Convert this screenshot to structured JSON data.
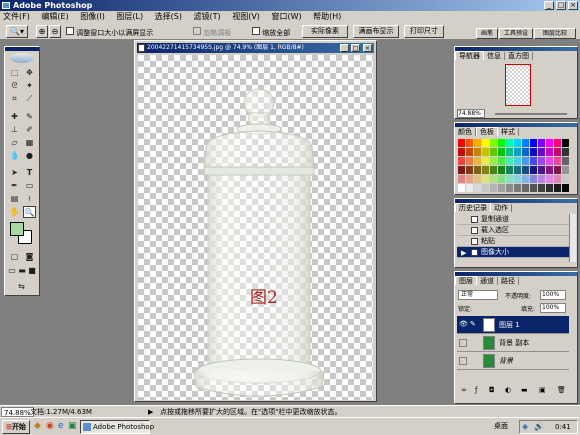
{
  "app": {
    "title": "Adobe Photoshop"
  },
  "menu": [
    "文件(F)",
    "编辑(E)",
    "图像(I)",
    "图层(L)",
    "选择(S)",
    "滤镜(T)",
    "视图(V)",
    "窗口(W)",
    "帮助(H)"
  ],
  "options": {
    "resize_window": "调整窗口大小以满屏显示",
    "ignore_palettes": "忽略调板",
    "zoom_all": "缩放全部",
    "actual_pixels": "实际像素",
    "fit_screen": "满画布显示",
    "print_size": "打印尺寸",
    "right_tabs": [
      "画笔",
      "工具预设",
      "图层比较"
    ]
  },
  "document": {
    "title": "2004227141573495S.jpg @ 74.9% (图层 1, RGB/8#)",
    "label": "图2",
    "label_color": "#b02020"
  },
  "navigator": {
    "tabs": [
      "导航器",
      "信息",
      "直方图"
    ],
    "zoom": "74.88%"
  },
  "color_panel": {
    "tabs": [
      "颜色",
      "色板",
      "样式"
    ]
  },
  "history": {
    "tabs": [
      "历史记录",
      "动作"
    ],
    "items": [
      {
        "label": "复制通道",
        "selected": false
      },
      {
        "label": "载入选区",
        "selected": false
      },
      {
        "label": "粘贴",
        "selected": false
      },
      {
        "label": "图像大小",
        "selected": true
      }
    ]
  },
  "layers": {
    "tabs": [
      "图层",
      "通道",
      "路径"
    ],
    "mode": "正常",
    "opacity_label": "不透明度:",
    "opacity": "100%",
    "lock_label": "锁定:",
    "fill_label": "填充:",
    "fill": "100%",
    "rows": [
      {
        "name": "图层 1",
        "selected": true
      },
      {
        "name": "背景 副本",
        "selected": false
      },
      {
        "name": "背景",
        "selected": false
      }
    ]
  },
  "status": {
    "zoom": "74.88%",
    "doc_size": "文档:1.27M/4.63M",
    "hint": "点按或拖移所要扩大的区域。在\"选项\"栏中更改缩放状态。"
  },
  "taskbar": {
    "start": "开始",
    "task": "Adobe Photoshop",
    "desktop": "桌面",
    "clock": "0:41"
  },
  "colors": {
    "accent": "#0a246a",
    "foreground_swatch": "#a8d8a0",
    "background_swatch": "#ffffff"
  }
}
